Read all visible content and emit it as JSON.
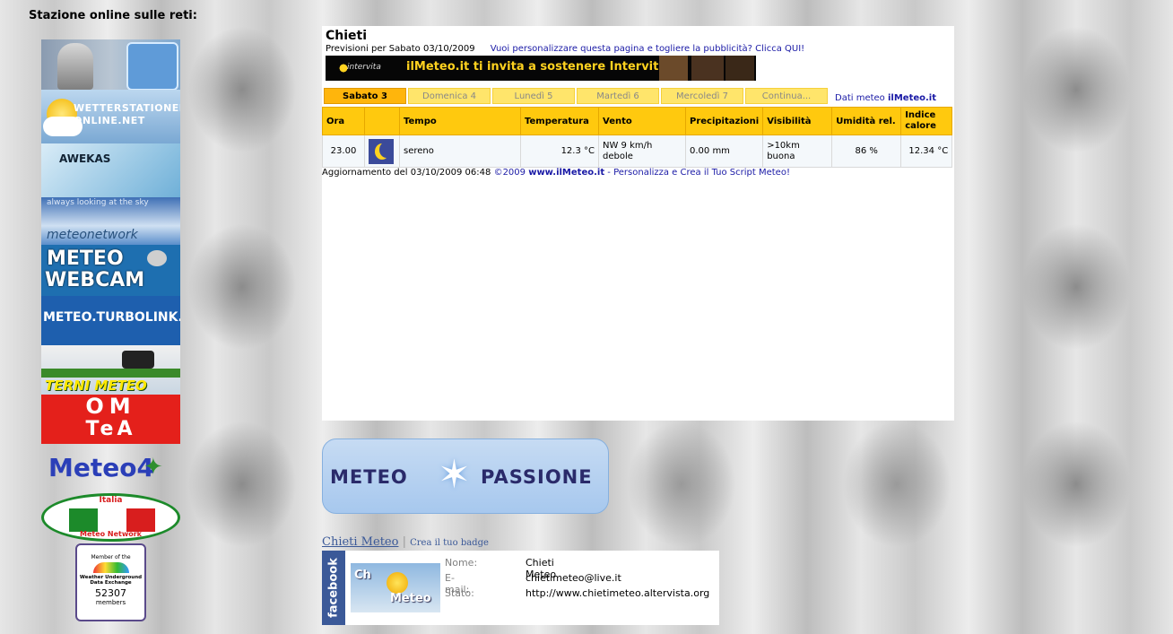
{
  "sidebar": {
    "title": "Stazione online sulle reti:",
    "logos": {
      "wetter": "WETTERSTATIONEN ONLINE.NET",
      "awekas": "AWEKAS",
      "meteonetwork_tag": "always looking at the sky",
      "meteonetwork": "meteonetwork",
      "webcam_1": "METEO",
      "webcam_2": "WEBCAM",
      "turbolink": "METEO.TURBOLINK.IT",
      "terni": "TERNI METEO",
      "omtea_1": "OM",
      "omtea_2": "TeA",
      "meteo4": "Meteo4",
      "italia_1": "Italia",
      "italia_2": "Meteo Network",
      "wu_1": "Member of the",
      "wu_2": "Weather Underground",
      "wu_3": "Data Exchange",
      "wu_count": "52307",
      "wu_4": "members"
    }
  },
  "widget": {
    "city": "Chieti",
    "subtitle": "Previsioni per Sabato 03/10/2009",
    "customize_link": "Vuoi personalizzare questa pagina e togliere la pubblicità? Clicca QUI!",
    "banner_brand": "intervita",
    "banner_text": "ilMeteo.it ti invita a sostenere Intervita",
    "tabs": [
      "Sabato 3",
      "Domenica 4",
      "Lunedì 5",
      "Martedì 6",
      "Mercoledì 7",
      "Continua..."
    ],
    "data_label": "Dati meteo",
    "data_brand": "ilMeteo.it",
    "headers": [
      "Ora",
      "Tempo",
      "Temperatura",
      "Vento",
      "Precipitazioni",
      "Visibilità",
      "Umidità rel.",
      "Indice calore"
    ],
    "row": {
      "ora": "23.00",
      "tempo": "sereno",
      "temperatura": "12.3 °C",
      "vento_1": "NW 9 km/h",
      "vento_2": "debole",
      "precipitazioni": "0.00 mm",
      "visibilita_1": ">10km",
      "visibilita_2": "buona",
      "umidita": "86 %",
      "indice": "12.34 °C"
    },
    "update_text": "Aggiornamento del 03/10/2009 06:48",
    "copyright": "©2009",
    "site": "www.ilMeteo.it",
    "script_link": "- Personalizza e Crea il Tuo Script Meteo!"
  },
  "meteopassione": {
    "left": "METEO",
    "right": "PASSIONE"
  },
  "facebook": {
    "name_link": "Chieti Meteo",
    "create_link": "Crea il tuo badge",
    "side_label": "facebook",
    "avatar_text_1": "Ch",
    "avatar_text_2": "Meteo",
    "fields": [
      {
        "label": "Nome:",
        "value": "Chieti Meteo"
      },
      {
        "label": "E-mail:",
        "value": "chietimeteo@live.it"
      },
      {
        "label": "Stato:",
        "value": "http://www.chietimeteo.altervista.org"
      }
    ]
  }
}
